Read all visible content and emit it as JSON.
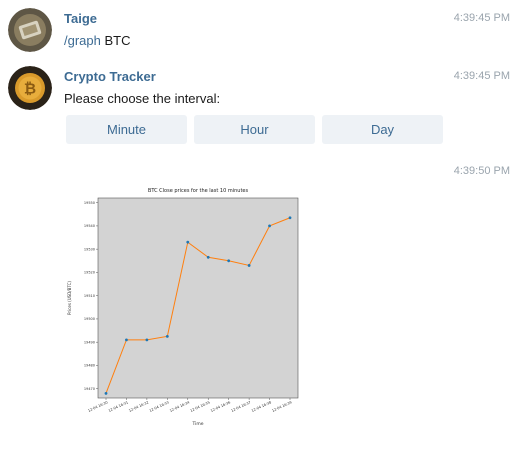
{
  "messages": [
    {
      "sender": "Taige",
      "time": "4:39:45 PM",
      "command": "/graph",
      "text": " BTC"
    },
    {
      "sender": "Crypto Tracker",
      "time": "4:39:45 PM",
      "text": "Please choose the interval:",
      "buttons": [
        "Minute",
        "Hour",
        "Day"
      ]
    },
    {
      "time": "4:39:50 PM"
    }
  ],
  "colors": {
    "sender": "#3d6b93",
    "time": "#9aa4ad",
    "button_bg": "#eef2f6",
    "plot_bg": "#d3d3d3",
    "line": "#ff7f0e",
    "marker": "#1f77b4"
  },
  "chart_data": {
    "type": "line",
    "title": "BTC Close prices for the last 10 minutes",
    "xlabel": "Time",
    "ylabel": "Prices (USD/BTC)",
    "categories": [
      "12-04 16:30",
      "12-04 16:31",
      "12-04 16:32",
      "12-04 16:33",
      "12-04 16:34",
      "12-04 16:35",
      "12-04 16:36",
      "12-04 16:37",
      "12-04 16:38",
      "12-04 16:39"
    ],
    "yticks": [
      19470,
      19480,
      19490,
      19500,
      19510,
      19520,
      19530,
      19540,
      19550
    ],
    "ylim": [
      19466,
      19552
    ],
    "values": [
      19468,
      19491,
      19491,
      19492.5,
      19533,
      19526.5,
      19525,
      19523,
      19540,
      19543.5
    ],
    "grid": false
  }
}
